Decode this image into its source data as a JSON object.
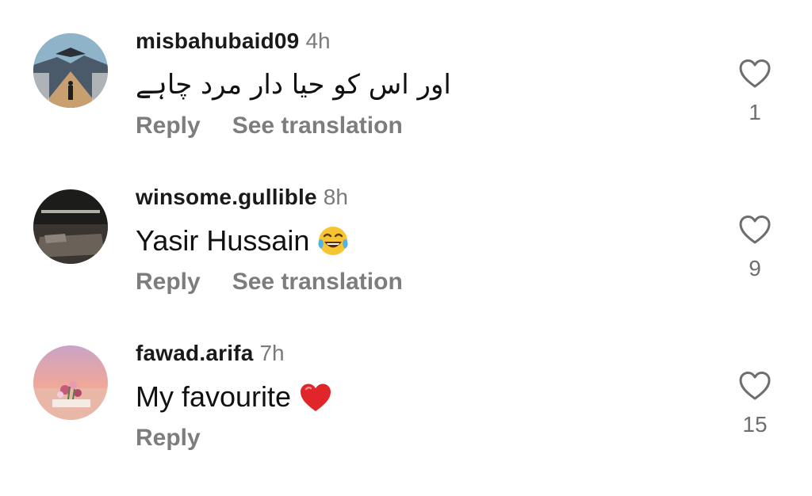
{
  "comments": [
    {
      "username": "misbahubaid09",
      "time": "4h",
      "text": "اور اس کو حیا دار مرد چاہے",
      "actions": {
        "reply": "Reply",
        "translate": "See translation"
      },
      "likes": "1"
    },
    {
      "username": "winsome.gullible",
      "time": "8h",
      "text": "Yasir Hussain",
      "emoji": "face-with-tears-of-joy",
      "actions": {
        "reply": "Reply",
        "translate": "See translation"
      },
      "likes": "9"
    },
    {
      "username": "fawad.arifa",
      "time": "7h",
      "text": "My favourite",
      "emoji": "red-heart",
      "actions": {
        "reply": "Reply"
      },
      "likes": "15"
    }
  ],
  "colors": {
    "username": "#1a1a1a",
    "muted": "#7d7d7d",
    "heart_outline": "#6e6e6e",
    "heart_emoji": "#e0252b"
  }
}
